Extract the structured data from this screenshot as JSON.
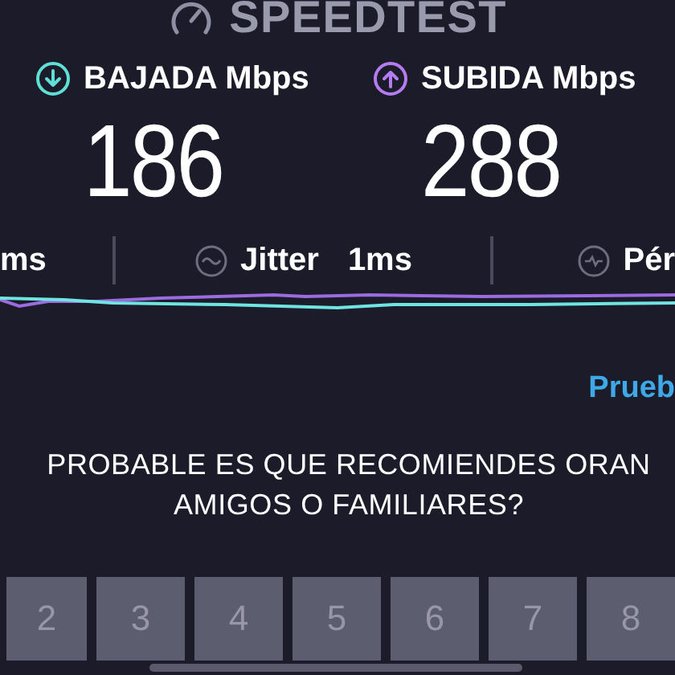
{
  "header": {
    "title": "SPEEDTEST"
  },
  "results": [
    {
      "kind": "download",
      "label": "BAJADA Mbps",
      "value": "186",
      "color": "#5fe0d6"
    },
    {
      "kind": "upload",
      "label": "SUBIDA Mbps",
      "value": "288",
      "color": "#b57cf2"
    }
  ],
  "stats": [
    {
      "kind": "ping",
      "value": "ms"
    },
    {
      "kind": "jitter",
      "label": "Jitter",
      "value": "1ms"
    },
    {
      "kind": "loss",
      "label": "Pér"
    }
  ],
  "link": "Prueb",
  "survey": {
    "question_lines": [
      "PROBABLE ES QUE RECOMIENDES ORAN",
      "AMIGOS O FAMILIARES?"
    ],
    "options": [
      "2",
      "3",
      "4",
      "5",
      "6",
      "7",
      "8"
    ]
  }
}
